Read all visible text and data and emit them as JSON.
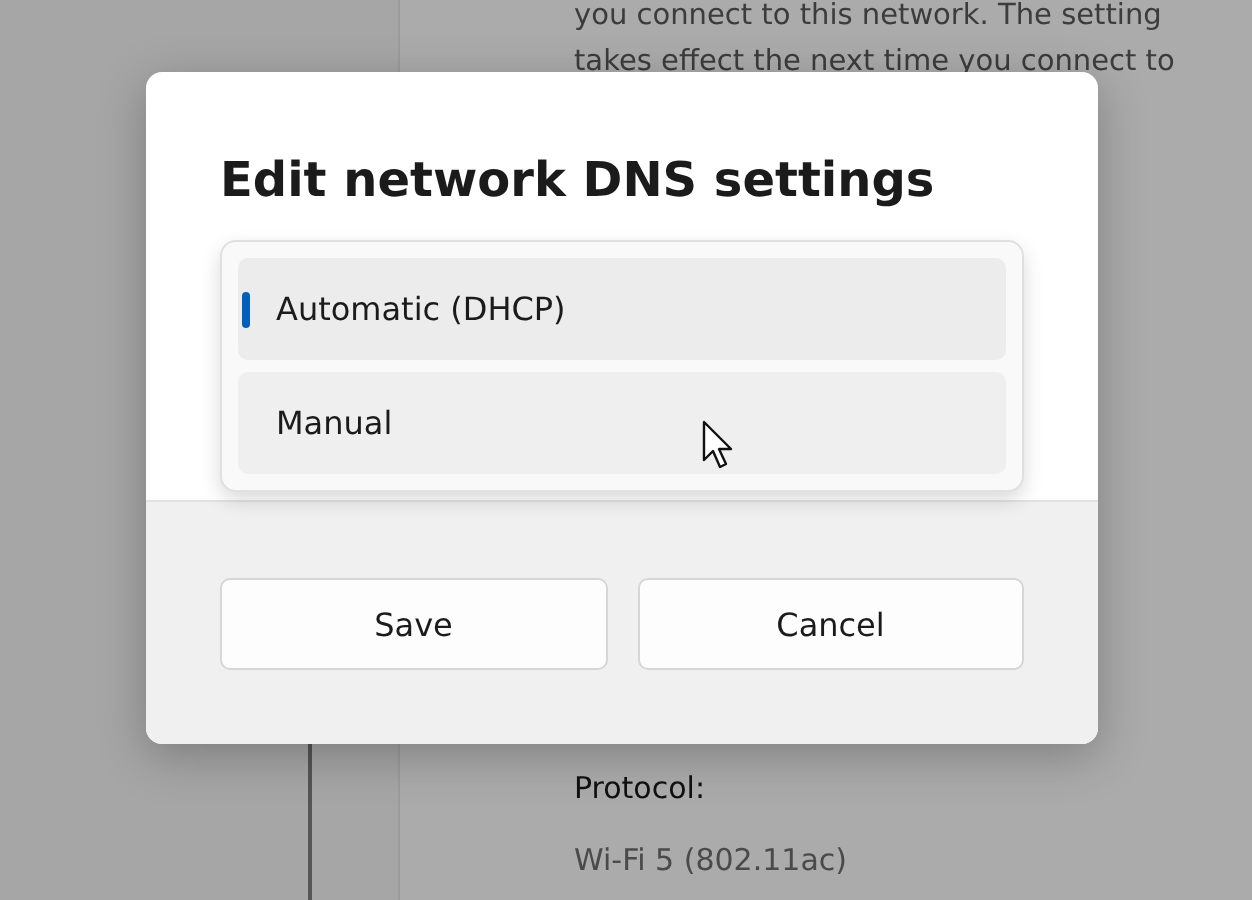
{
  "background": {
    "description_lines": [
      "you connect to this network. The setting",
      "takes effect the next time you connect to"
    ],
    "protocol_label": "Protocol:",
    "protocol_value": "Wi-Fi 5 (802.11ac)"
  },
  "dialog": {
    "title": "Edit network DNS settings",
    "dropdown": {
      "options": [
        {
          "label": "Automatic (DHCP)",
          "selected": true
        },
        {
          "label": "Manual",
          "selected": false
        }
      ]
    },
    "buttons": [
      "Save",
      "Cancel"
    ]
  }
}
